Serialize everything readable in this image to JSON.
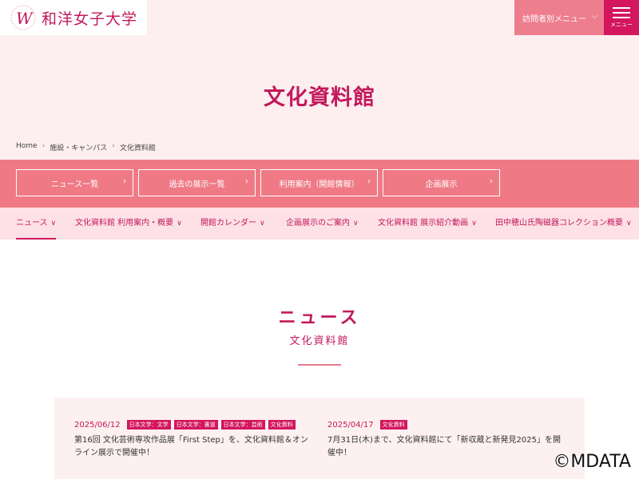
{
  "header": {
    "logo_text": "和洋女子大学",
    "visitor_menu_label": "訪問者別メニュー",
    "menu_label": "メニュー"
  },
  "page": {
    "title": "文化資料館"
  },
  "breadcrumb": [
    "Home",
    "施設・キャンパス",
    "文化資料館"
  ],
  "band_links": [
    {
      "label": "ニュース一覧"
    },
    {
      "label": "過去の展示一覧"
    },
    {
      "label": "利用案内（開館情報）"
    },
    {
      "label": "企画展示"
    }
  ],
  "subnav": [
    {
      "label": "ニュース"
    },
    {
      "label": "文化資料館 利用案内・概要"
    },
    {
      "label": "開館カレンダー"
    },
    {
      "label": "企画展示のご案内"
    },
    {
      "label": "文化資料館 展示紹介動画"
    },
    {
      "label": "田中穂山氏陶磁器コレクション概要"
    }
  ],
  "section": {
    "title": "ニュース",
    "subtitle": "文化資料館"
  },
  "news": [
    {
      "date": "2025/06/12",
      "tags": [
        "日本文学：文学",
        "日本文学：書道",
        "日本文学：芸術",
        "文化資料"
      ],
      "text": "第16回 文化芸術専攻作品展「First Step」を、文化資料館＆オンライン展示で開催中！"
    },
    {
      "date": "2025/04/17",
      "tags": [
        "文化資料"
      ],
      "text": "7月31日(木)まで、文化資料館にて「新収蔵と新発見2025」を開催中！"
    }
  ],
  "watermark": "©MDATA",
  "colors": {
    "brand": "#c2185b",
    "accent": "#d3165d",
    "band": "#ef7a86",
    "hero_bg": "#fdeef0",
    "subnav_bg": "#fde1e6"
  }
}
